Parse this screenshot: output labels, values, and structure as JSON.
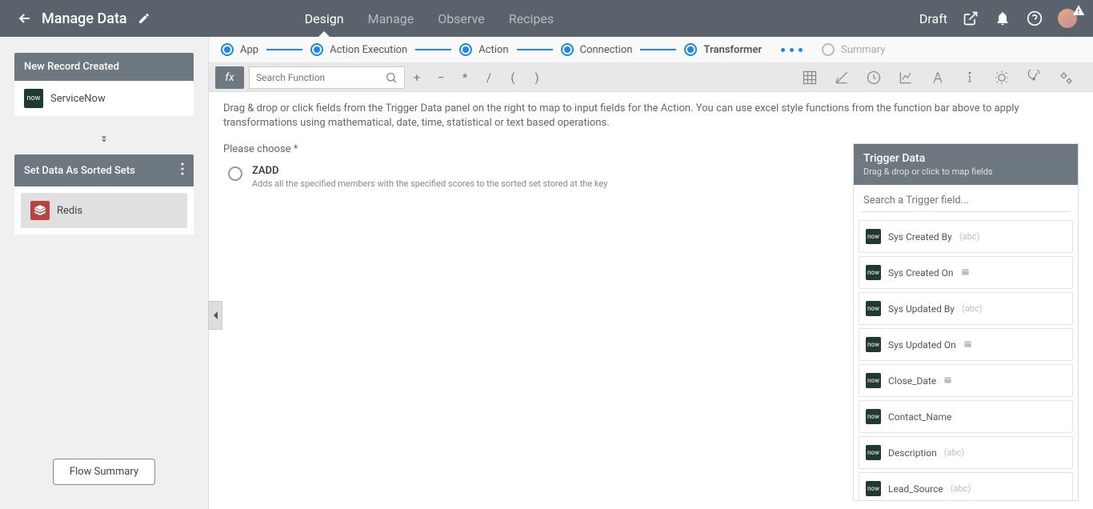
{
  "header": {
    "title": "Manage Data",
    "tabs": [
      "Design",
      "Manage",
      "Observe",
      "Recipes"
    ],
    "status": "Draft"
  },
  "sidebar": {
    "trigger_card": {
      "title": "New Record Created",
      "app": "ServiceNow"
    },
    "action_card": {
      "title": "Set Data As Sorted Sets",
      "app": "Redis"
    },
    "summary_btn": "Flow Summary"
  },
  "steps": [
    "App",
    "Action Execution",
    "Action",
    "Connection",
    "Transformer",
    "Summary"
  ],
  "funcbar": {
    "search_placeholder": "Search Function",
    "ops": [
      "+",
      "−",
      "*",
      "/",
      "(",
      ")"
    ]
  },
  "help_text": "Drag & drop or click fields from the Trigger Data panel on the right to map to input fields for the Action. You can use excel style functions from the function bar above to apply transformations using mathematical, date, time, statistical or text based operations.",
  "choose_label": "Please choose *",
  "option": {
    "title": "ZADD",
    "desc": "Adds all the specified members with the specified scores to the sorted set stored at the key"
  },
  "trigger_panel": {
    "title": "Trigger Data",
    "subtitle": "Drag & drop or click to map fields",
    "search_placeholder": "Search a Trigger field...",
    "fields": [
      {
        "label": "Sys Created By",
        "type": "abc"
      },
      {
        "label": "Sys Created On",
        "type": "date"
      },
      {
        "label": "Sys Updated By",
        "type": "abc"
      },
      {
        "label": "Sys Updated On",
        "type": "date"
      },
      {
        "label": "Close_Date",
        "type": "date"
      },
      {
        "label": "Contact_Name",
        "type": ""
      },
      {
        "label": "Description",
        "type": "abc"
      },
      {
        "label": "Lead_Source",
        "type": "abc"
      }
    ]
  }
}
